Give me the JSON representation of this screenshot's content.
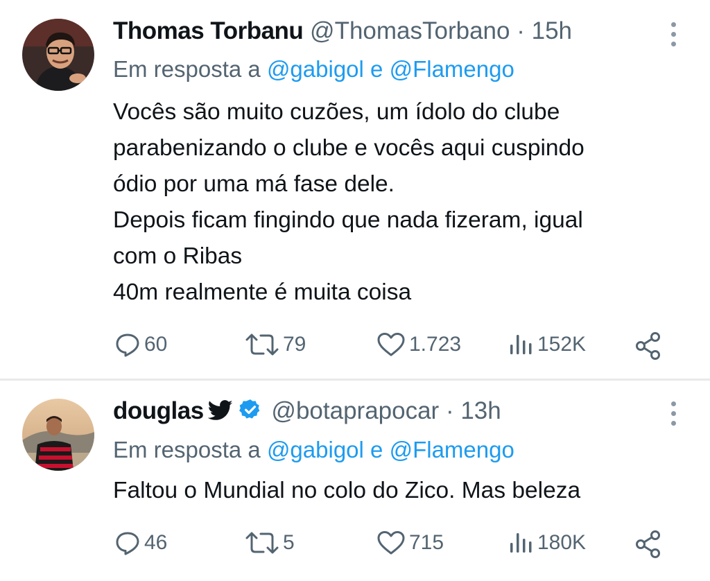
{
  "tweets": [
    {
      "name": "Thomas Torbanu",
      "handle": "@ThomasTorbano",
      "separator": "·",
      "time": "15h",
      "reply_prefix": "Em resposta a",
      "mention1": "@gabigol",
      "conj": "e",
      "mention2": "@Flamengo",
      "lines": [
        "Vocês são muito cuzões, um ídolo do clube",
        "parabenizando o clube e vocês aqui cuspindo",
        "ódio por uma má fase dele.",
        "Depois ficam fingindo que nada fizeram, igual",
        "com o Ribas",
        "40m realmente é muita coisa"
      ],
      "replies": "60",
      "retweets": "79",
      "likes": "1.723",
      "views": "152K"
    },
    {
      "name": "douglas",
      "handle": "@botaprapocar",
      "separator": "·",
      "time": "13h",
      "reply_prefix": "Em resposta a",
      "mention1": "@gabigol",
      "conj": "e",
      "mention2": "@Flamengo",
      "lines": [
        "Faltou o Mundial no colo do Zico. Mas beleza"
      ],
      "replies": "46",
      "retweets": "5",
      "likes": "715",
      "views": "180K"
    }
  ],
  "colors": {
    "text": "#0f1419",
    "secondary": "#536471",
    "link": "#1d9bf0",
    "verified": "#1d9bf0",
    "divider": "#e7e9ea"
  },
  "icons": [
    "more-vertical-icon",
    "reply-icon",
    "retweet-icon",
    "like-icon",
    "views-icon",
    "share-icon",
    "twitter-bird-icon",
    "verified-badge-icon"
  ]
}
